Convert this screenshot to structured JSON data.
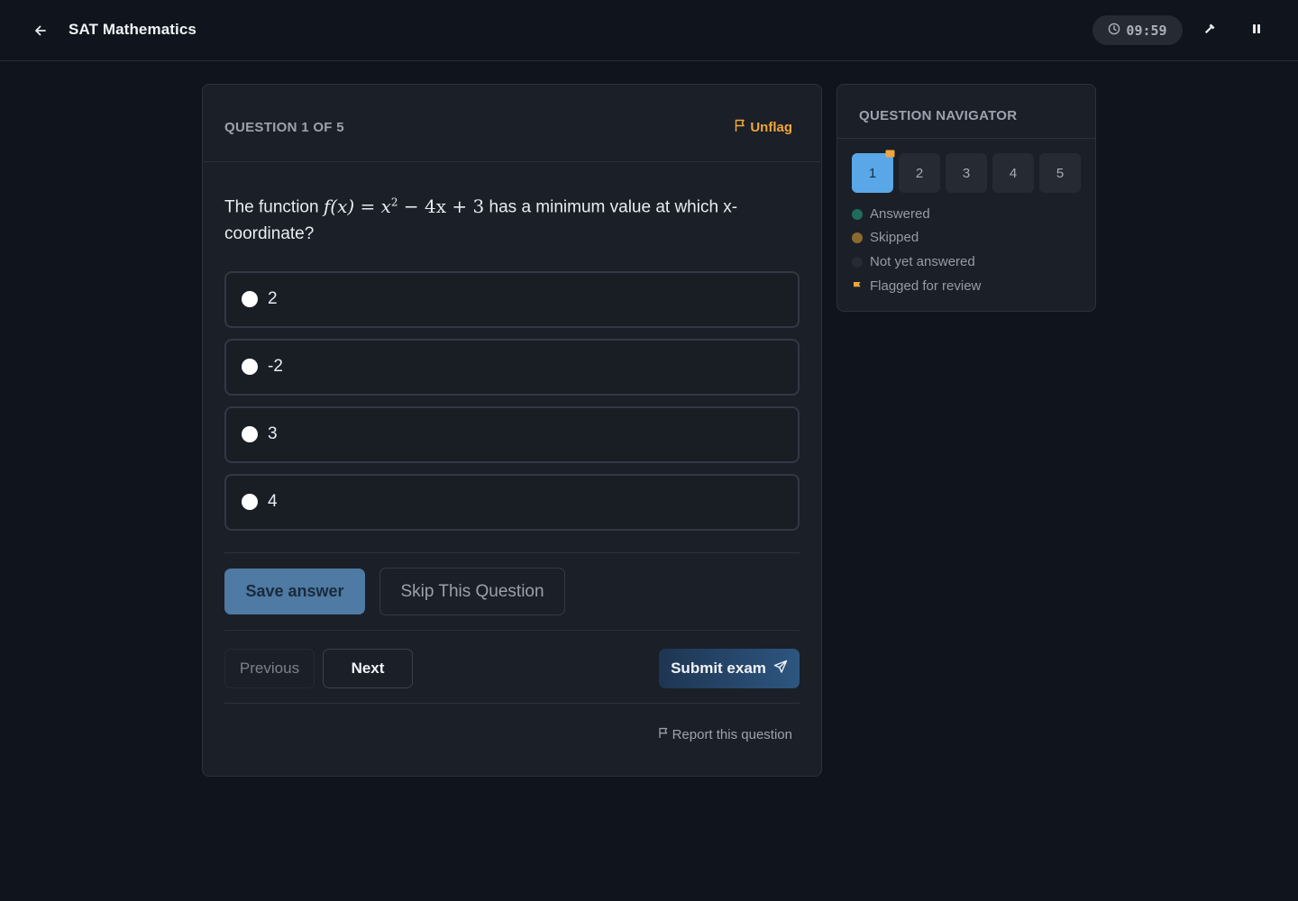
{
  "header": {
    "title": "SAT Mathematics",
    "timer": "09:59"
  },
  "question": {
    "counter": "QUESTION 1 OF 5",
    "unflag_label": "Unflag",
    "text_before": "The function",
    "text_after": "has a minimum value at which x-coordinate?",
    "math": {
      "fx": "f(x)",
      "eq": "=",
      "x": "x",
      "exp": "2",
      "rest": "− 4x + 3"
    },
    "options": [
      {
        "label": "2"
      },
      {
        "label": "-2"
      },
      {
        "label": "3"
      },
      {
        "label": "4"
      }
    ]
  },
  "actions": {
    "save_label": "Save answer",
    "skip_label": "Skip This Question",
    "previous_label": "Previous",
    "next_label": "Next",
    "submit_label": "Submit exam",
    "report_label": "Report this question"
  },
  "navigator": {
    "title": "QUESTION NAVIGATOR",
    "numbers": [
      "1",
      "2",
      "3",
      "4",
      "5"
    ],
    "legend": [
      {
        "label": "Answered",
        "color": "#1f6b5e"
      },
      {
        "label": "Skipped",
        "color": "#8a6a2e"
      },
      {
        "label": "Not yet answered",
        "color": "#252a33"
      },
      {
        "label": "Flagged for review",
        "color": "#f0a63a"
      }
    ]
  },
  "colors": {
    "accent_blue": "#5aa7e8",
    "flag_orange": "#f0a63a",
    "background": "#10141c",
    "card": "#1b1f27"
  }
}
